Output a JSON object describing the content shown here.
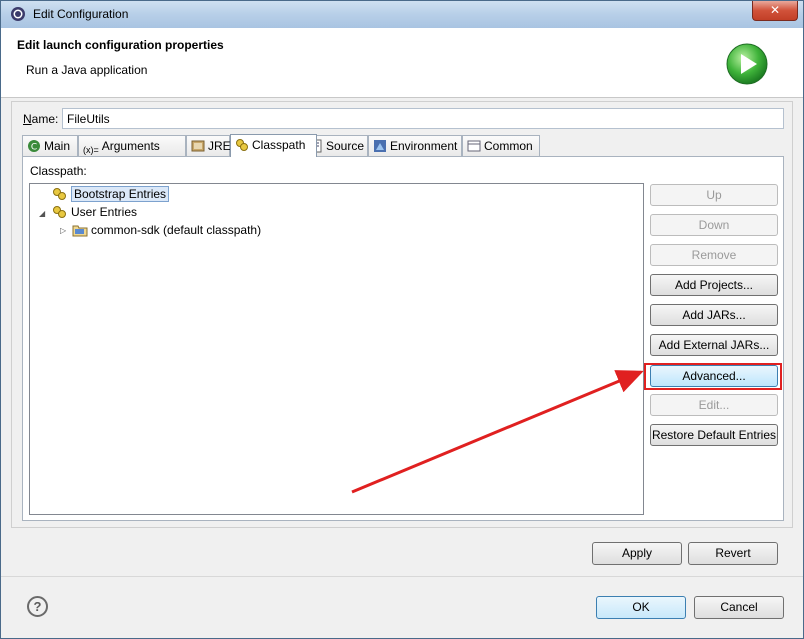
{
  "window": {
    "title": "Edit Configuration",
    "close_label": "✕"
  },
  "header": {
    "title": "Edit launch configuration properties",
    "subtitle": "Run a Java application"
  },
  "name": {
    "label": "Name:",
    "value": "FileUtils"
  },
  "tabs": [
    {
      "label": "Main",
      "icon": "main-tab-icon"
    },
    {
      "label": "Arguments",
      "icon": "arguments-tab-icon"
    },
    {
      "label": "JRE",
      "icon": "jre-tab-icon"
    },
    {
      "label": "Classpath",
      "icon": "classpath-tab-icon",
      "active": true
    },
    {
      "label": "Source",
      "icon": "source-tab-icon"
    },
    {
      "label": "Environment",
      "icon": "environment-tab-icon"
    },
    {
      "label": "Common",
      "icon": "common-tab-icon"
    }
  ],
  "classpath": {
    "label": "Classpath:",
    "tree": [
      {
        "label": "Bootstrap Entries",
        "selected": true
      },
      {
        "label": "User Entries",
        "expanded": true
      },
      {
        "label": "common-sdk (default classpath)"
      }
    ]
  },
  "side_buttons": [
    {
      "label": "Up",
      "enabled": false
    },
    {
      "label": "Down",
      "enabled": false
    },
    {
      "label": "Remove",
      "enabled": false
    },
    {
      "label": "Add Projects...",
      "enabled": true
    },
    {
      "label": "Add JARs...",
      "enabled": true
    },
    {
      "label": "Add External JARs...",
      "enabled": true
    },
    {
      "label": "Advanced...",
      "enabled": true,
      "highlighted": true
    },
    {
      "label": "Edit...",
      "enabled": false
    },
    {
      "label": "Restore Default Entries",
      "enabled": true
    }
  ],
  "actions": {
    "apply": "Apply",
    "revert": "Revert",
    "ok": "OK",
    "cancel": "Cancel",
    "help": "?"
  },
  "colors": {
    "annotation": "#e02020",
    "selection": "#dbe8f8"
  }
}
